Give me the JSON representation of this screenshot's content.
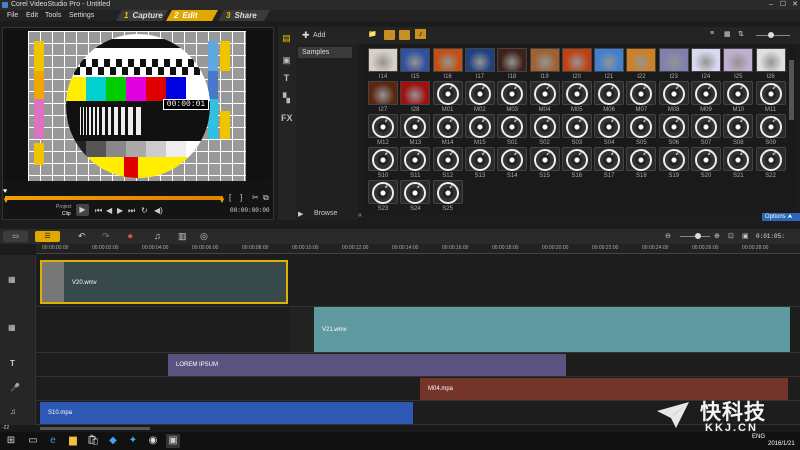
{
  "window": {
    "title": "Corel VideoStudio Pro - Untitled",
    "minimize": "–",
    "maximize": "☐",
    "close": "✕"
  },
  "menu": [
    "File",
    "Edit",
    "Tools",
    "Settings"
  ],
  "steps": [
    {
      "num": "1",
      "label": "Capture"
    },
    {
      "num": "2",
      "label": "Edit",
      "active": true
    },
    {
      "num": "3",
      "label": "Share"
    }
  ],
  "player": {
    "timecode": "00:00:01",
    "mode_project": "Project",
    "mode_clip": "Clip",
    "duration": "00:00:00:00"
  },
  "library": {
    "add_label": "Add",
    "folder": "Samples",
    "browse_label": "Browse",
    "options_label": "Options",
    "video_thumbs": [
      "I14",
      "I15",
      "I16",
      "I17",
      "I18",
      "I19",
      "I20",
      "I21",
      "I22",
      "I23",
      "I24",
      "I25",
      "I26"
    ],
    "row2": [
      "I27",
      "I28",
      "M01",
      "M02",
      "M03",
      "M04",
      "M05",
      "M06",
      "M07",
      "M08",
      "M09",
      "M10",
      "M11"
    ],
    "row3": [
      "M12",
      "M13",
      "M14",
      "M15",
      "S01",
      "S02",
      "S03",
      "S04",
      "S05",
      "S06",
      "S07",
      "S08",
      "S09"
    ],
    "row4": [
      "S10",
      "S11",
      "S12",
      "S13",
      "S14",
      "S15",
      "S16",
      "S17",
      "S18",
      "S19",
      "S20",
      "S21",
      "S22"
    ],
    "row5": [
      "S23",
      "S24",
      "S25"
    ]
  },
  "timeline": {
    "zoom_timecode": "0:01:05:",
    "ruler": [
      "00:00:00:00",
      "00:00:02:00",
      "00:00:04:00",
      "00:00:06:00",
      "00:00:08:00",
      "00:00:10:00",
      "00:00:12:00",
      "00:00:14:00",
      "00:00:16:00",
      "00:00:18:00",
      "00:00:20:00",
      "00:00:22:00",
      "00:00:24:00",
      "00:00:26:00",
      "00:00:28:00"
    ],
    "clips": {
      "video1": "V20.wmv",
      "overlay": "V21.wmv",
      "title": "LOREM IPSUM",
      "voice": "M04.mpa",
      "music": "S10.mpa"
    },
    "zoom_label": "-22"
  },
  "taskbar": {
    "time": "2016/1/21",
    "lang": "ENG"
  },
  "watermark": {
    "brand": "快科技",
    "site": "KKJ.CN"
  },
  "colors": {
    "accent": "#e0a800",
    "video_clip": "#37494b",
    "overlay_clip": "#5e9aa0",
    "title_clip": "#5a5380",
    "voice_clip": "#73352a",
    "music_clip": "#2d58b4"
  }
}
